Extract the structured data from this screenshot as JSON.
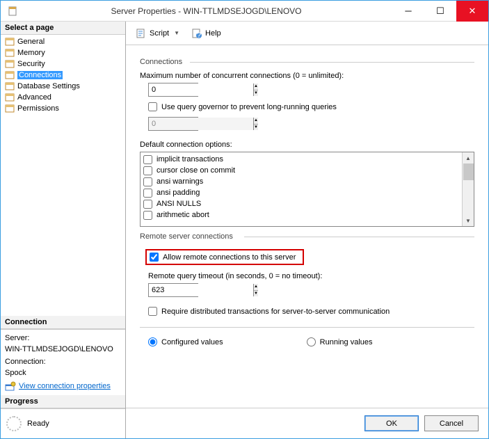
{
  "window": {
    "title": "Server Properties - WIN-TTLMDSEJOGD\\LENOVO"
  },
  "left": {
    "select_page_label": "Select a page",
    "pages": [
      {
        "label": "General"
      },
      {
        "label": "Memory"
      },
      {
        "label": "Security"
      },
      {
        "label": "Connections",
        "selected": true
      },
      {
        "label": "Database Settings"
      },
      {
        "label": "Advanced"
      },
      {
        "label": "Permissions"
      }
    ],
    "connection": {
      "heading": "Connection",
      "server_label": "Server:",
      "server_value": "WIN-TTLMDSEJOGD\\LENOVO",
      "conn_label": "Connection:",
      "conn_value": "Spock",
      "view_props": "View connection properties"
    },
    "progress": {
      "heading": "Progress",
      "status": "Ready"
    }
  },
  "toolbar": {
    "script": "Script",
    "help": "Help"
  },
  "form": {
    "group_connections": "Connections",
    "max_conn_label": "Maximum number of concurrent connections (0 = unlimited):",
    "max_conn_value": "0",
    "use_governor": "Use query governor to prevent long-running queries",
    "governor_value": "0",
    "default_opts_label": "Default connection options:",
    "options": [
      "implicit transactions",
      "cursor close on commit",
      "ansi warnings",
      "ansi padding",
      "ANSI NULLS",
      "arithmetic abort"
    ],
    "group_remote": "Remote server connections",
    "allow_remote": "Allow remote connections to this server",
    "remote_timeout_label": "Remote query timeout (in seconds, 0 = no timeout):",
    "remote_timeout_value": "623",
    "require_dist": "Require distributed transactions for server-to-server communication",
    "radio_configured": "Configured values",
    "radio_running": "Running values"
  },
  "footer": {
    "ok": "OK",
    "cancel": "Cancel"
  }
}
